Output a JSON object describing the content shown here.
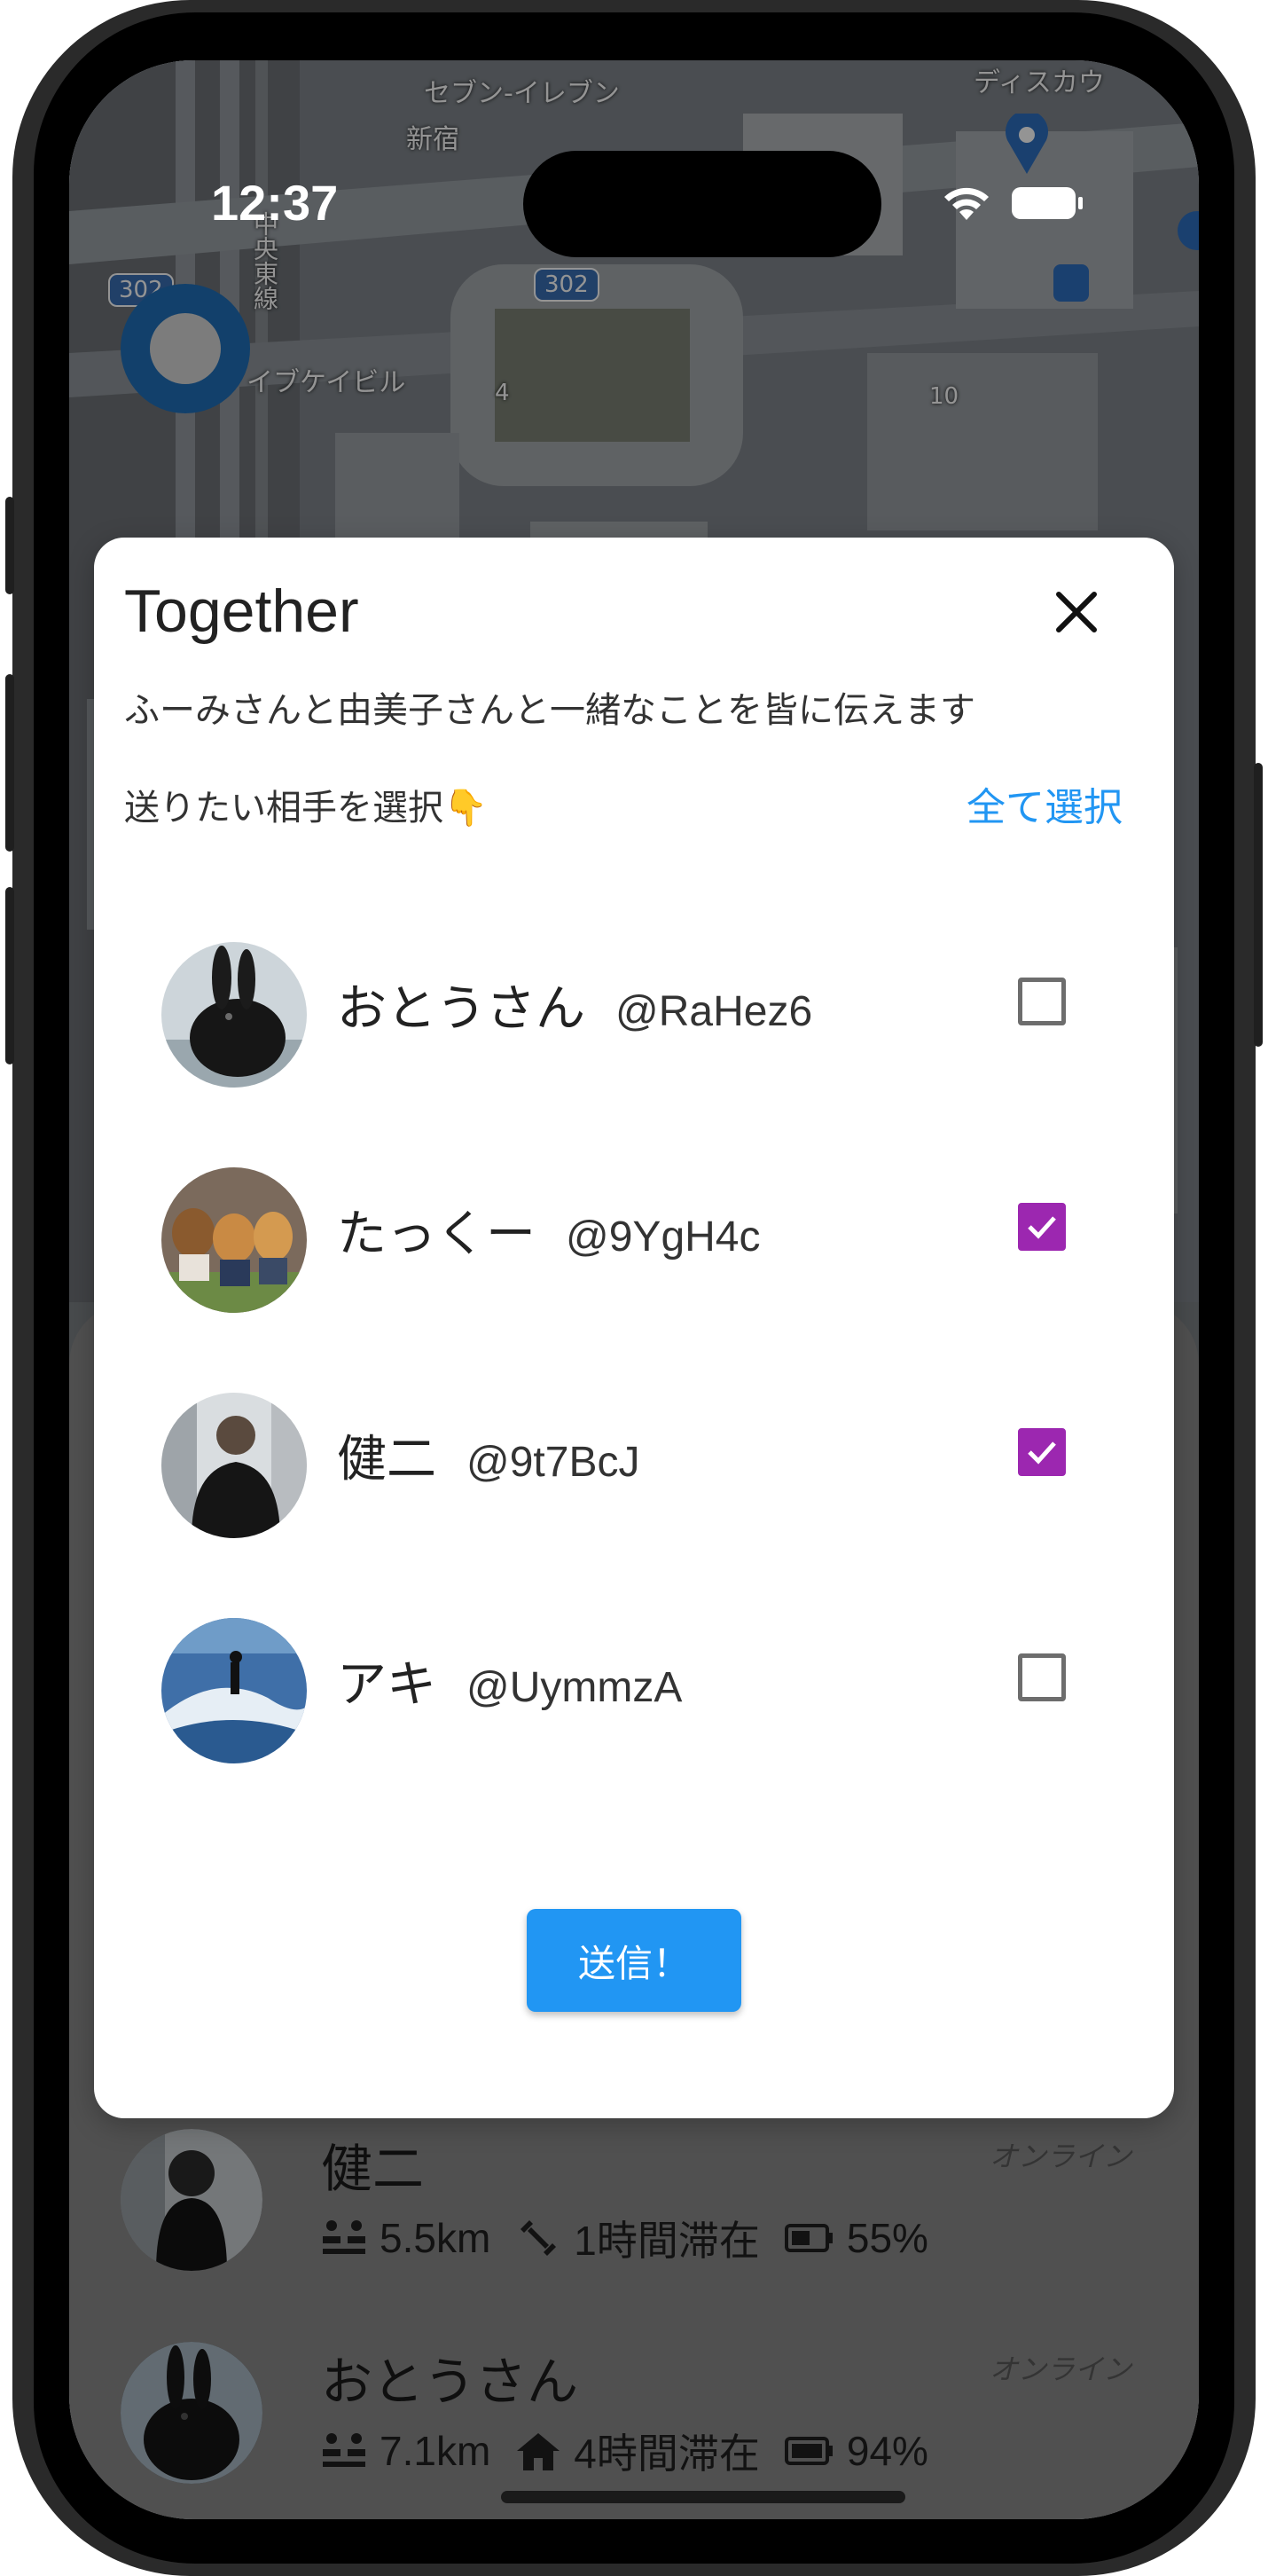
{
  "status_bar": {
    "time": "12:37"
  },
  "dialog": {
    "title": "Together",
    "description": "ふーみさんと由美子さんと一緒なことを皆に伝えます",
    "prompt": "送りたい相手を選択👇",
    "select_all": "全て選択",
    "send_label": "送信！",
    "members": [
      {
        "name": "おとうさん",
        "handle": "@RaHez6",
        "checked": false,
        "avatar": "black-rabbit"
      },
      {
        "name": "たっくー",
        "handle": "@9YgH4c",
        "checked": true,
        "avatar": "three-dogs"
      },
      {
        "name": "健二",
        "handle": "@9t7BcJ",
        "checked": true,
        "avatar": "gym-man"
      },
      {
        "name": "アキ",
        "handle": "@UymmzA",
        "checked": false,
        "avatar": "surfer"
      }
    ]
  },
  "background_list": [
    {
      "name": "健二",
      "status": "オンライン",
      "distance": "5.5km",
      "stay": "1時間滞在",
      "battery": "55%"
    },
    {
      "name": "おとうさん",
      "status": "オンライン",
      "distance": "7.1km",
      "stay": "4時間滞在",
      "battery": "94%"
    }
  ],
  "map_labels": {
    "route_a": "302",
    "route_b": "302",
    "building": "イブケイビル",
    "rail_line": "中央東線",
    "shop": "ディスカウ",
    "seven": "セブン-イレブン",
    "side_label": "新宿",
    "marker_10": "10",
    "marker_4": "4"
  },
  "colors": {
    "accent": "#2196f3",
    "checkbox_checked": "#9c27b0",
    "dialog_bg": "#ffffff"
  }
}
